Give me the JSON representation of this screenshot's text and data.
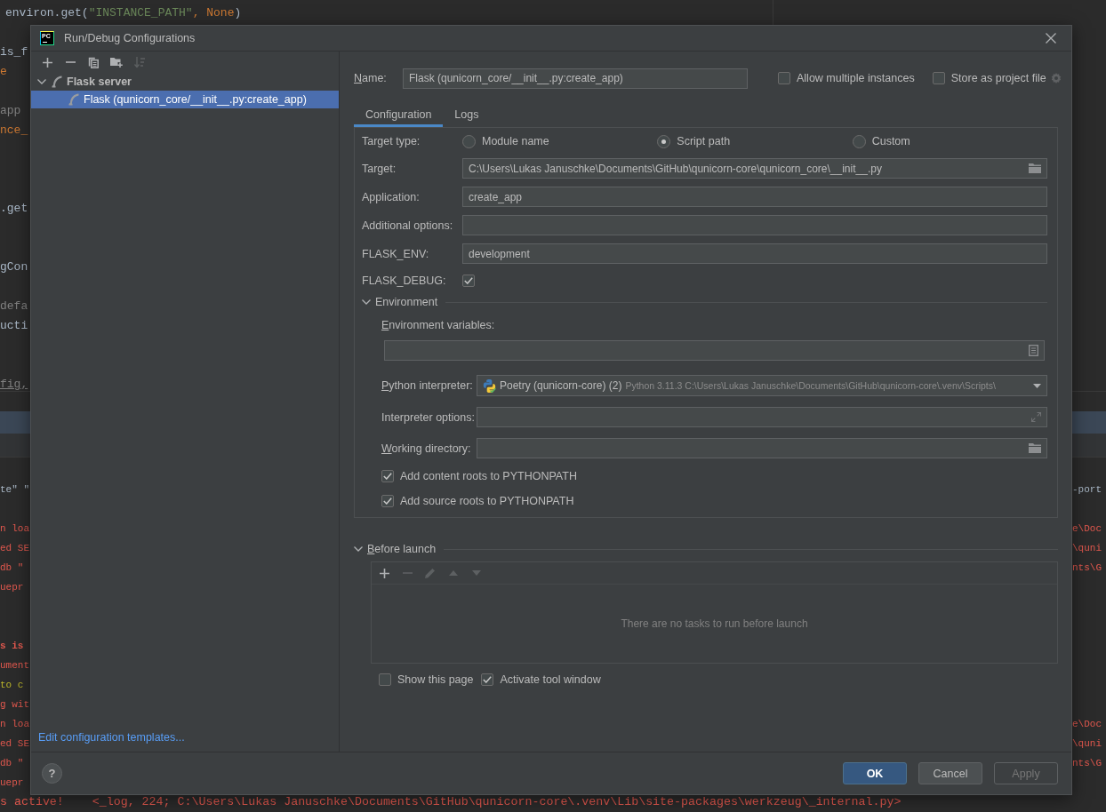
{
  "ide_background": {
    "editor_top_line": [
      {
        "text": "environ.get(",
        "kind": "plain"
      },
      {
        "text": "\"INSTANCE_PATH\"",
        "kind": "string"
      },
      {
        "text": ", None",
        "kind": "keyword"
      },
      {
        "text": ")",
        "kind": "plain"
      }
    ],
    "editor_fragments": [
      {
        "text": "is_f",
        "kind": "plain"
      },
      {
        "text": "e",
        "kind": "keyword"
      },
      {
        "text": "app",
        "kind": "comment"
      },
      {
        "text": "nce_",
        "kind": "keyword"
      },
      {
        "text": ".get",
        "kind": "plain"
      },
      {
        "text": "gCon",
        "kind": "plain"
      },
      {
        "text": "defa",
        "kind": "comment"
      },
      {
        "text": "ucti",
        "kind": "plain"
      },
      {
        "text": "fig,",
        "kind": "underlined"
      }
    ],
    "console_left": [
      {
        "text": "te\" \"",
        "kind": "plain"
      },
      {
        "text": "n loa",
        "kind": "error"
      },
      {
        "text": "ed SE",
        "kind": "error"
      },
      {
        "text": "db \"",
        "kind": "error"
      },
      {
        "text": "uepr",
        "kind": "error"
      },
      {
        "text": "s is",
        "kind": "error_bold"
      },
      {
        "text": "ument",
        "kind": "error"
      },
      {
        "text": "to c",
        "kind": "warning"
      },
      {
        "text": "g wit",
        "kind": "error"
      },
      {
        "text": "n loa",
        "kind": "error"
      },
      {
        "text": "ed SE",
        "kind": "error"
      },
      {
        "text": "db \"",
        "kind": "error"
      },
      {
        "text": "uepr",
        "kind": "error"
      }
    ],
    "console_right": [
      {
        "text": "-port",
        "kind": "plain"
      },
      {
        "text": "e\\Doc",
        "kind": "error"
      },
      {
        "text": "\\quni",
        "kind": "error"
      },
      {
        "text": "nts\\G",
        "kind": "error"
      },
      {
        "text": "e\\Doc",
        "kind": "error"
      },
      {
        "text": "\\quni",
        "kind": "error"
      },
      {
        "text": "nts\\G",
        "kind": "error"
      }
    ],
    "console_last_line": {
      "text": "s active!    <_log, 224; C:\\Users\\Lukas Januschke\\Documents\\GitHub\\qunicorn-core\\.venv\\Lib\\site-packages\\werkzeug\\_internal.py>",
      "kind": "error"
    }
  },
  "dialog": {
    "logo": "PC",
    "title": "Run/Debug Configurations",
    "toolbar": [
      {
        "kind": "add",
        "disabled": false
      },
      {
        "kind": "remove",
        "disabled": false
      },
      {
        "kind": "copy",
        "disabled": false
      },
      {
        "kind": "new_folder",
        "disabled": false
      },
      {
        "kind": "sort",
        "disabled": true
      }
    ],
    "tree": [
      {
        "label": "Flask server",
        "selected": false,
        "expanded": true,
        "children": [
          {
            "label": "Flask (qunicorn_core/__init__.py:create_app)",
            "selected": true
          }
        ]
      }
    ],
    "templates_link": "Edit configuration templates...",
    "name_field": {
      "label": "Name:",
      "mnemonic": true,
      "value": "Flask (qunicorn_core/__init__.py:create_app)"
    },
    "options": [
      {
        "label": "Allow multiple instances",
        "checked": false
      },
      {
        "label": "Store as project file",
        "checked": false
      }
    ],
    "tabs": [
      {
        "label": "Configuration",
        "selected": true
      },
      {
        "label": "Logs",
        "selected": false
      }
    ],
    "configuration": {
      "rows": [
        {
          "kind": "radio_group",
          "label": "Target type:",
          "options": [
            {
              "label": "Module name",
              "selected": false
            },
            {
              "label": "Script path",
              "selected": true
            },
            {
              "label": "Custom",
              "selected": false
            }
          ]
        },
        {
          "kind": "text_field",
          "label": "Target:",
          "value": "C:\\Users\\Lukas Januschke\\Documents\\GitHub\\qunicorn-core\\qunicorn_core\\__init__.py"
        },
        {
          "kind": "text_field",
          "label": "Application:",
          "value": "create_app"
        },
        {
          "kind": "text_field",
          "label": "Additional options:"
        },
        {
          "kind": "text_field",
          "label": "FLASK_ENV:",
          "value": "development"
        },
        {
          "kind": "checkbox",
          "label": "FLASK_DEBUG:",
          "checked": true
        }
      ],
      "environment": {
        "title": "Environment",
        "expanded": true,
        "variables": {
          "label": "Environment variables:",
          "mnemonic": true
        },
        "rows": [
          {
            "kind": "dropdown",
            "label": "Python interpreter:",
            "mnemonic": true,
            "value": "Poetry (qunicorn-core) (2)",
            "detail": "Python 3.11.3 C:\\Users\\Lukas Januschke\\Documents\\GitHub\\qunicorn-core\\.venv\\Scripts\\"
          },
          {
            "kind": "text_field",
            "label": "Interpreter options:",
            "mnemonic": false
          },
          {
            "kind": "text_field",
            "label": "Working directory:",
            "mnemonic": true
          }
        ],
        "checkboxes": [
          {
            "label": "Add content roots to PYTHONPATH",
            "checked": true
          },
          {
            "label": "Add source roots to PYTHONPATH",
            "checked": true
          }
        ]
      }
    },
    "before_launch": {
      "title": "Before launch",
      "mnemonic": true,
      "expanded": true,
      "toolbar": [
        {
          "kind": "add",
          "disabled": false
        },
        {
          "kind": "remove",
          "disabled": true
        },
        {
          "kind": "edit",
          "disabled": true
        },
        {
          "kind": "move_up",
          "disabled": true
        },
        {
          "kind": "move_down",
          "disabled": true
        }
      ],
      "empty_text": "There are no tasks to run before launch",
      "options": [
        {
          "label": "Show this page",
          "checked": false
        },
        {
          "label": "Activate tool window",
          "checked": true
        }
      ]
    },
    "help": "?",
    "buttons": [
      {
        "label": "OK",
        "kind": "primary",
        "disabled": false
      },
      {
        "label": "Cancel",
        "kind": "normal",
        "disabled": false
      },
      {
        "label": "Apply",
        "kind": "normal",
        "disabled": true
      }
    ]
  }
}
